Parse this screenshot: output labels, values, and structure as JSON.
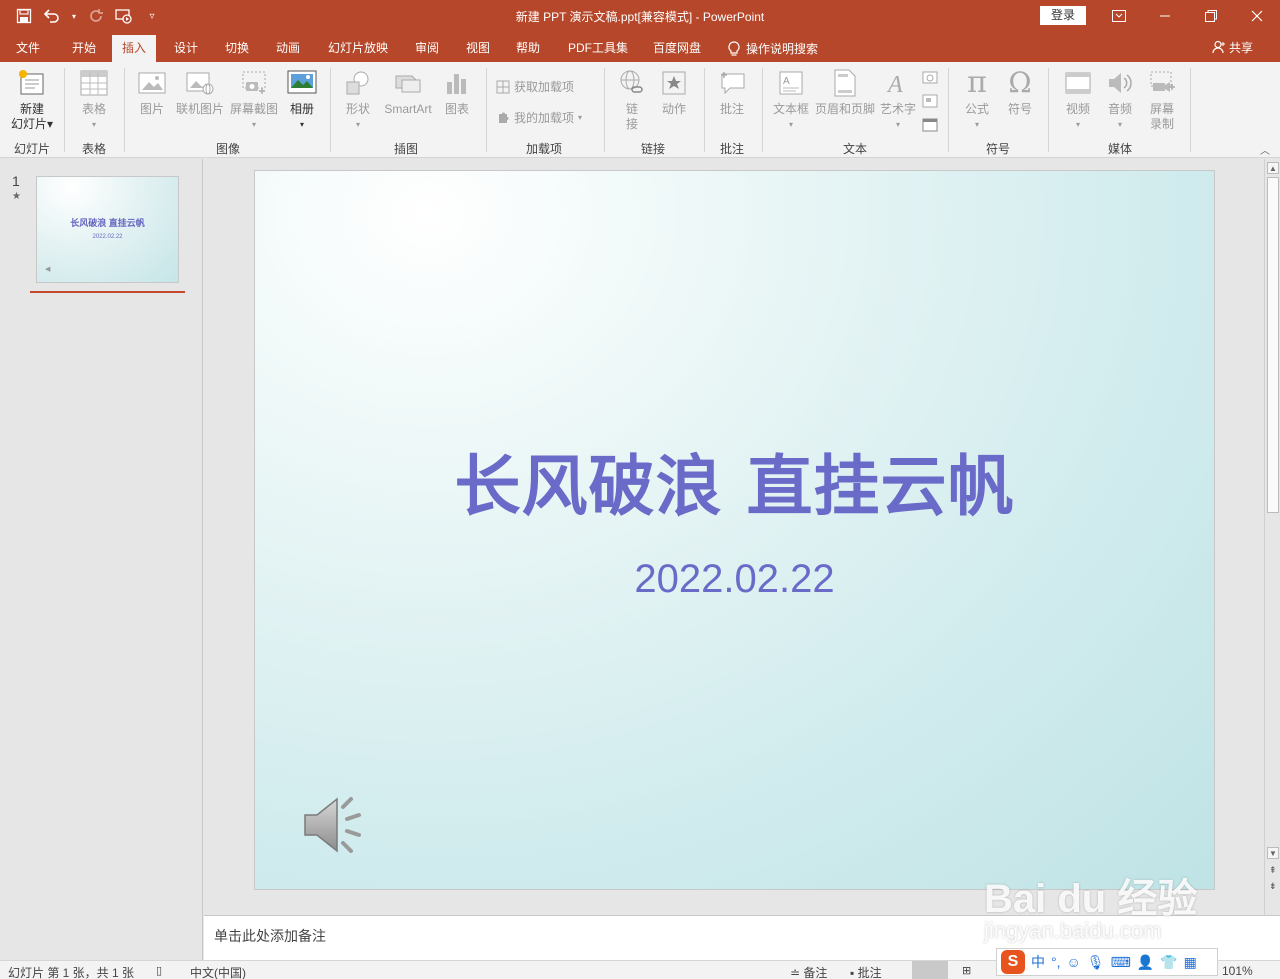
{
  "window": {
    "title": "新建 PPT 演示文稿.ppt[兼容模式] - PowerPoint",
    "login_label": "登录",
    "colors": {
      "accent": "#b7472a",
      "slide_text": "#6a6ac8"
    }
  },
  "qat": {
    "save_icon": "save-icon",
    "undo_icon": "undo-icon",
    "redo_icon": "redo-icon",
    "present_icon": "present-from-start-icon",
    "customize_icon": "customize-qat-icon"
  },
  "menu": {
    "tabs": [
      {
        "label": "文件"
      },
      {
        "label": "开始"
      },
      {
        "label": "插入"
      },
      {
        "label": "设计"
      },
      {
        "label": "切换"
      },
      {
        "label": "动画"
      },
      {
        "label": "幻灯片放映"
      },
      {
        "label": "审阅"
      },
      {
        "label": "视图"
      },
      {
        "label": "帮助"
      },
      {
        "label": "PDF工具集"
      },
      {
        "label": "百度网盘"
      }
    ],
    "active_tab": "插入",
    "tell_me": "操作说明搜索",
    "share": "共享"
  },
  "ribbon": {
    "buttons": {
      "new_slide": [
        "新建",
        "幻灯片"
      ],
      "table": "表格",
      "picture": "图片",
      "online_picture": "联机图片",
      "screenshot": "屏幕截图",
      "album": "相册",
      "shapes": "形状",
      "smartart": "SmartArt",
      "chart": "图表",
      "get_addins": "获取加载项",
      "my_addins": "我的加载项",
      "link": [
        "链",
        "接"
      ],
      "action": "动作",
      "comment": "批注",
      "textbox": "文本框",
      "header_footer": "页眉和页脚",
      "wordart": "艺术字",
      "equation": "公式",
      "symbol": "符号",
      "video": "视频",
      "audio": "音频",
      "screen_record": [
        "屏幕",
        "录制"
      ]
    },
    "groups": {
      "slides": "幻灯片",
      "tables": "表格",
      "images": "图像",
      "illustrations": "插图",
      "addins": "加载项",
      "links": "链接",
      "comments": "批注",
      "text": "文本",
      "symbols": "符号",
      "media": "媒体"
    }
  },
  "thumbnails": [
    {
      "number": "1",
      "star": "★",
      "title": "长风破浪 直挂云帆",
      "date": "2022.02.22"
    }
  ],
  "slide": {
    "title": "长风破浪 直挂云帆",
    "date": "2022.02.22"
  },
  "notes": {
    "placeholder": "单击此处添加备注"
  },
  "status": {
    "slide_info": "幻灯片 第 1 张，共 1 张",
    "language": "中文(中国)",
    "notes_btn": "备注",
    "comments_btn": "批注",
    "zoom": "101%"
  },
  "watermark": {
    "main": "Bai du 经验",
    "sub": "jingyan.baidu.com"
  },
  "ime": {
    "mode": "中",
    "punct": "°,"
  }
}
